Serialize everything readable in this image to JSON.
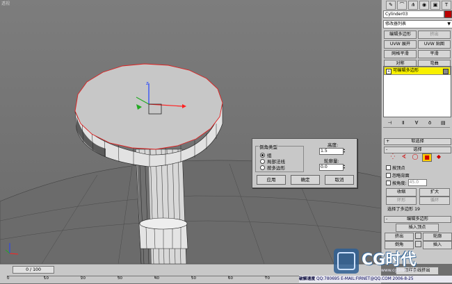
{
  "viewport": {
    "label": "透视"
  },
  "command_panel": {
    "tabs": [
      "create-tab",
      "modify-tab",
      "hierarchy-tab",
      "motion-tab",
      "display-tab",
      "utilities-tab"
    ],
    "object_name": "Cylinder03",
    "object_color": "#b00000",
    "modifier_list": "修改器列表",
    "modifier_buttons": [
      {
        "label": "编辑多边形",
        "dim": false
      },
      {
        "label": "挤出",
        "dim": true
      },
      {
        "label": "UVW 展开",
        "dim": false
      },
      {
        "label": "UVW 贴图",
        "dim": false
      },
      {
        "label": "网格平滑",
        "dim": false
      },
      {
        "label": "平滑",
        "dim": false
      },
      {
        "label": "对称",
        "dim": false
      },
      {
        "label": "弯曲",
        "dim": false
      }
    ],
    "stack_item": "可编辑多边形",
    "rollouts": {
      "soft_selection": "软选择",
      "selection": "选择",
      "edit_polygons": "编辑多边形"
    },
    "selection": {
      "by_vertex": "按顶点",
      "ignore_backfacing": "忽略背面",
      "by_angle": "按角度:",
      "angle_value": "45.0",
      "shrink": "收缩",
      "grow": "扩大",
      "ring": "环形",
      "loop": "循环",
      "info": "选择了多边形 19"
    },
    "edit_polygons": {
      "insert_vertex": "插入顶点",
      "extrude": "挤出",
      "outline": "轮廓",
      "bevel": "倒角",
      "inset": "插入",
      "bottom": "沿样条线挤出"
    }
  },
  "bevel_dialog": {
    "group_title": "倒角类型",
    "options": [
      {
        "label": "组",
        "selected": true
      },
      {
        "label": "局部法线",
        "selected": false
      },
      {
        "label": "按多边形",
        "selected": false
      }
    ],
    "height_label": "高度:",
    "height_value": "1.5",
    "outline_label": "轮廓量:",
    "outline_value": "0.0",
    "apply": "应用",
    "ok": "确定",
    "cancel": "取消"
  },
  "timeline": {
    "frame": "0 / 100",
    "ticks": [
      "0",
      "10",
      "20",
      "30",
      "40",
      "50",
      "60",
      "70",
      "80",
      "90",
      "100"
    ]
  },
  "status": {
    "brand": "破解速度",
    "contact": "QQ:780695 E-MAIL:FIRNET@QQ.COM",
    "date": "2006-8-25"
  },
  "watermark": {
    "text": "CG时代",
    "url": "www.cgtime.com"
  }
}
